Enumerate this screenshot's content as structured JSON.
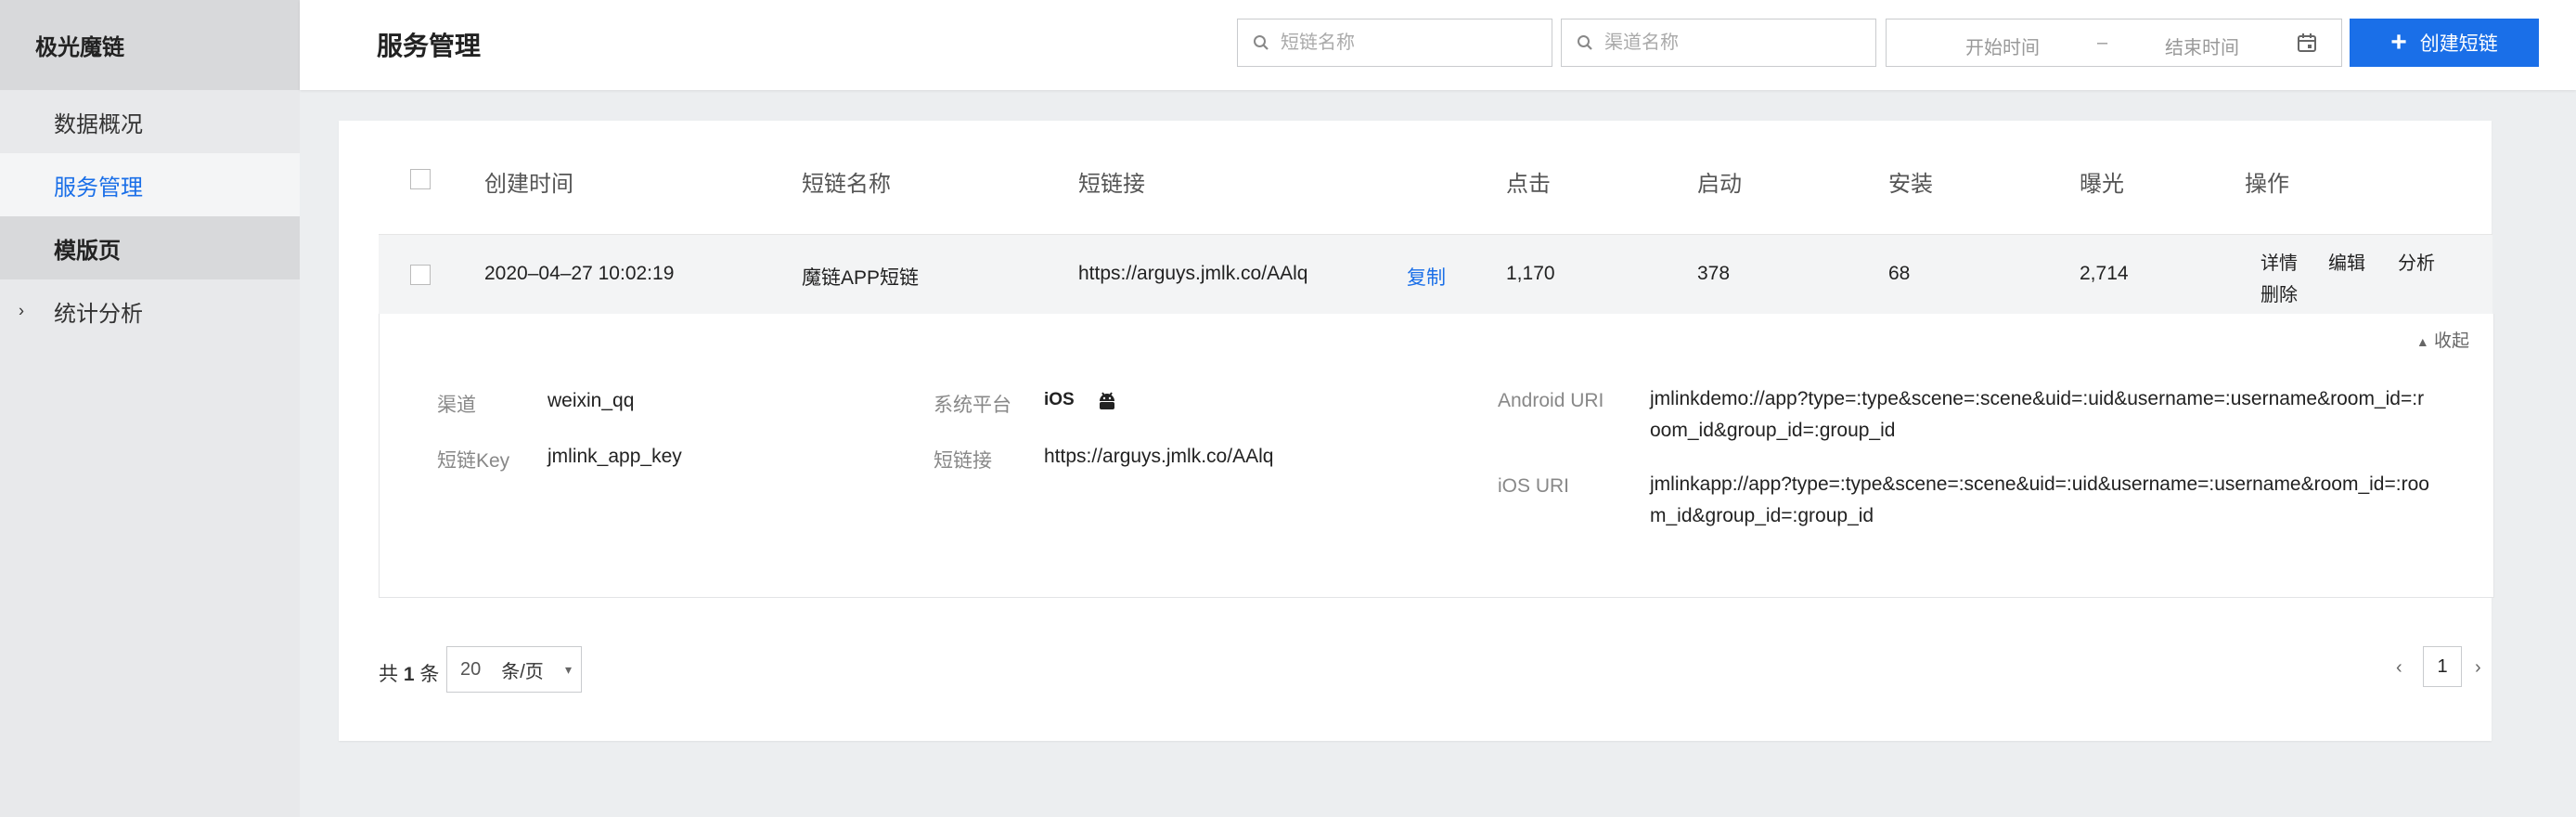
{
  "sidebar": {
    "logo": "极光魔链",
    "items": [
      {
        "label": "数据概况"
      },
      {
        "label": "服务管理"
      },
      {
        "label": "模版页"
      },
      {
        "label": "统计分析"
      }
    ]
  },
  "header": {
    "title": "服务管理",
    "search_short_link_placeholder": "短链名称",
    "search_channel_placeholder": "渠道名称",
    "start_time_placeholder": "开始时间",
    "range_separator": "–",
    "end_time_placeholder": "结束时间",
    "create_button": "创建短链"
  },
  "table": {
    "columns": [
      "创建时间",
      "短链名称",
      "短链接",
      "点击",
      "启动",
      "安装",
      "曝光",
      "操作"
    ],
    "row": {
      "created": "2020–04–27 10:02:19",
      "name": "魔链APP短链",
      "url": "https://arguys.jmlk.co/AAlq",
      "copy": "复制",
      "clicks": "1,170",
      "launches": "378",
      "installs": "68",
      "exposures": "2,714",
      "ops": [
        "详情",
        "编辑",
        "分析",
        "删除"
      ]
    },
    "detail": {
      "collapse": "收起",
      "channel_label": "渠道",
      "channel": "weixin_qq",
      "key_label": "短链Key",
      "key": "jmlink_app_key",
      "platform_label": "系统平台",
      "platform_ios": "iOS",
      "short_link_label": "短链接",
      "short_link": "https://arguys.jmlk.co/AAlq",
      "android_uri_label": "Android URI",
      "android_uri": "jmlinkdemo://app?type=:type&scene=:scene&uid=:uid&username=:username&room_id=:room_id&group_id=:group_id",
      "ios_uri_label": "iOS URI",
      "ios_uri": "jmlinkapp://app?type=:type&scene=:scene&uid=:uid&username=:username&room_id=:room_id&group_id=:group_id"
    }
  },
  "pagination": {
    "total_prefix": "共",
    "total": "1",
    "total_suffix": "条",
    "page_size": "20",
    "page_size_unit": "条/页",
    "current_page": "1"
  },
  "colors": {
    "accent": "#1a6fe8",
    "sidebar_bg": "#e8e9eb"
  }
}
